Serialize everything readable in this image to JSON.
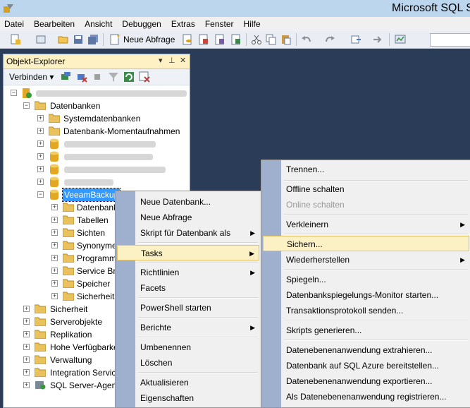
{
  "window": {
    "title": "Microsoft SQL Se"
  },
  "menubar": [
    "Datei",
    "Bearbeiten",
    "Ansicht",
    "Debuggen",
    "Extras",
    "Fenster",
    "Hilfe"
  ],
  "toolbar": {
    "new_query_label": "Neue Abfrage"
  },
  "object_explorer": {
    "title": "Objekt-Explorer",
    "connect_label": "Verbinden",
    "pin": "▾ ⊥ ✕",
    "tree": {
      "databases": "Datenbanken",
      "system_databases": "Systemdatenbanken",
      "snapshots": "Datenbank-Momentaufnahmen",
      "selected_db": "VeeamBackup",
      "db_children": [
        "Datenbank",
        "Tabellen",
        "Sichten",
        "Synonyme",
        "Programm",
        "Service Bro",
        "Speicher",
        "Sicherheit"
      ],
      "server_children": [
        "Sicherheit",
        "Serverobjekte",
        "Replikation",
        "Hohe Verfügbarke",
        "Verwaltung",
        "Integration Servic",
        "SQL Server-Agent"
      ]
    }
  },
  "context_menu": {
    "items": [
      {
        "label": "Neue Datenbank..."
      },
      {
        "label": "Neue Abfrage"
      },
      {
        "label": "Skript für Datenbank als",
        "submenu": true
      },
      {
        "label": "Tasks",
        "submenu": true,
        "highlighted": true
      },
      {
        "label": "Richtlinien",
        "submenu": true
      },
      {
        "label": "Facets"
      },
      {
        "label": "PowerShell starten"
      },
      {
        "label": "Berichte",
        "submenu": true
      },
      {
        "label": "Umbenennen"
      },
      {
        "label": "Löschen"
      },
      {
        "label": "Aktualisieren"
      },
      {
        "label": "Eigenschaften"
      }
    ]
  },
  "tasks_menu": {
    "items": [
      {
        "label": "Trennen..."
      },
      {
        "label": "Offline schalten"
      },
      {
        "label": "Online schalten",
        "disabled": true
      },
      {
        "label": "Verkleinern",
        "submenu": true
      },
      {
        "label": "Sichern...",
        "highlighted": true
      },
      {
        "label": "Wiederherstellen",
        "submenu": true
      },
      {
        "label": "Spiegeln..."
      },
      {
        "label": "Datenbankspiegelungs-Monitor starten..."
      },
      {
        "label": "Transaktionsprotokoll senden..."
      },
      {
        "label": "Skripts generieren..."
      },
      {
        "label": "Datenebenenanwendung extrahieren..."
      },
      {
        "label": "Datenbank auf SQL Azure bereitstellen..."
      },
      {
        "label": "Datenebenenanwendung exportieren..."
      },
      {
        "label": "Als Datenebenenanwendung registrieren..."
      }
    ]
  },
  "submenu_arrow": "▶",
  "colors": {
    "highlight_bg": "#fcf1c4",
    "highlight_border": "#e5c365",
    "selection": "#3399ff",
    "panel_header": "#fef2c4"
  }
}
